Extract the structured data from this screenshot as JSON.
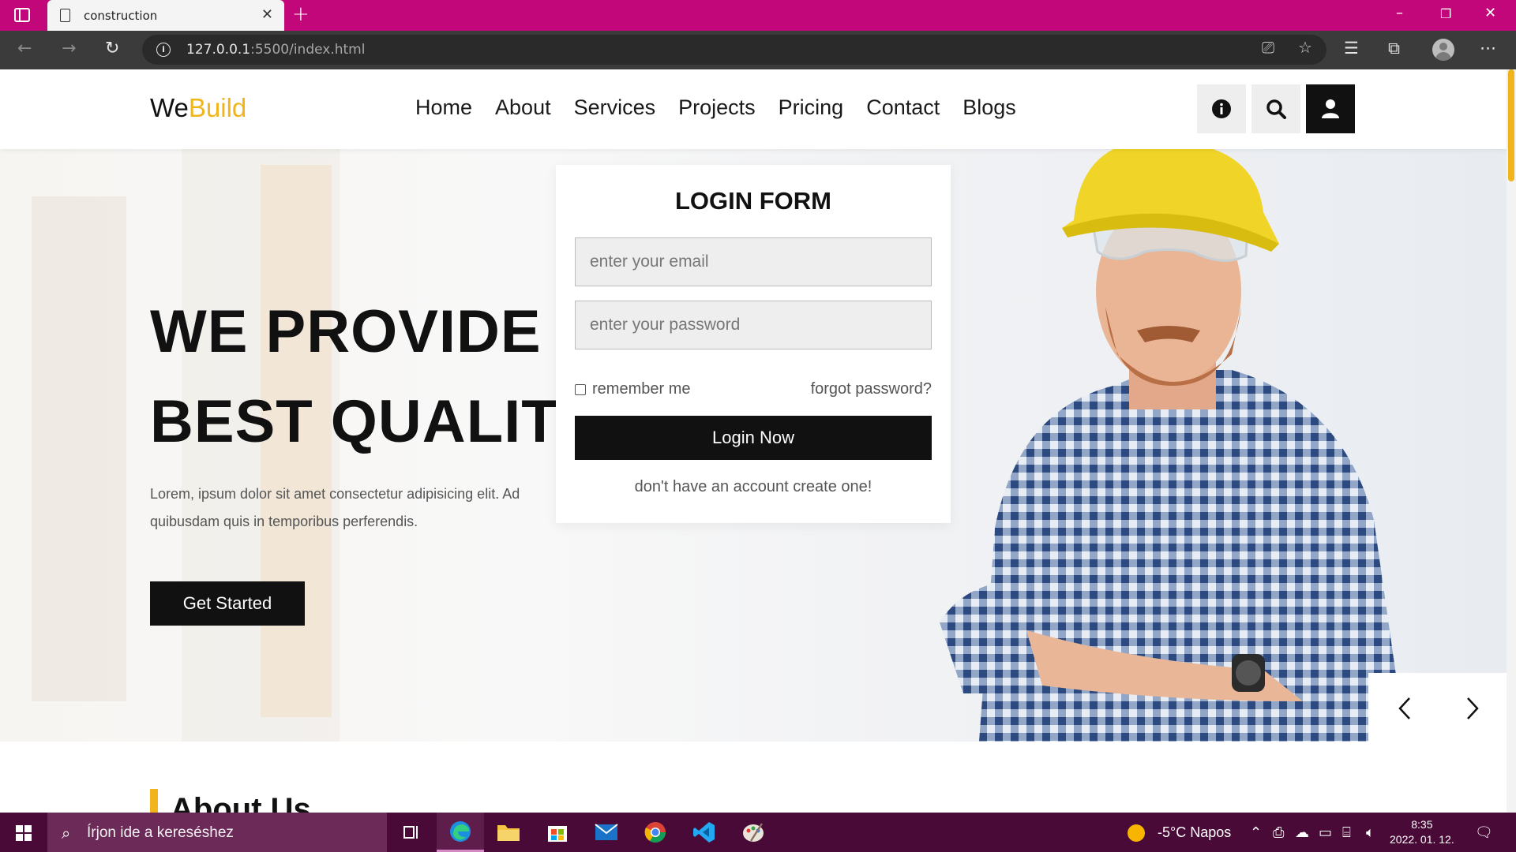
{
  "browser": {
    "tab_title": "construction",
    "new_tab_symbol": "+",
    "url_host": "127.0.0.1",
    "url_rest": ":5500/index.html",
    "window_controls": {
      "minimize": "–",
      "restore": "❐",
      "close": "✕"
    }
  },
  "site": {
    "logo_main": "We",
    "logo_accent": "Build",
    "accent_color": "#f2b41b",
    "nav": [
      "Home",
      "About",
      "Services",
      "Projects",
      "Pricing",
      "Contact",
      "Blogs"
    ],
    "header_buttons": [
      "info-icon",
      "search-icon",
      "user-icon"
    ]
  },
  "hero": {
    "title_line1": "WE PROVIDE",
    "title_line2": "BEST QUALITY",
    "text_line1": "Lorem, ipsum dolor sit amet consectetur adipisicing elit. Ad",
    "text_line2": "quibusdam quis in temporibus perferendis.",
    "cta": "Get Started"
  },
  "login_form": {
    "title": "LOGIN FORM",
    "email_placeholder": "enter your email",
    "password_placeholder": "enter your password",
    "remember_label": "remember me",
    "forgot_label": "forgot password?",
    "submit_label": "Login Now",
    "signup_text": "don't have an account create one!"
  },
  "about": {
    "heading": "About Us"
  },
  "taskbar": {
    "search_placeholder": "Írjon ide a kereséshez",
    "weather": "-5°C  Napos",
    "time": "8:35",
    "date": "2022. 01. 12."
  }
}
